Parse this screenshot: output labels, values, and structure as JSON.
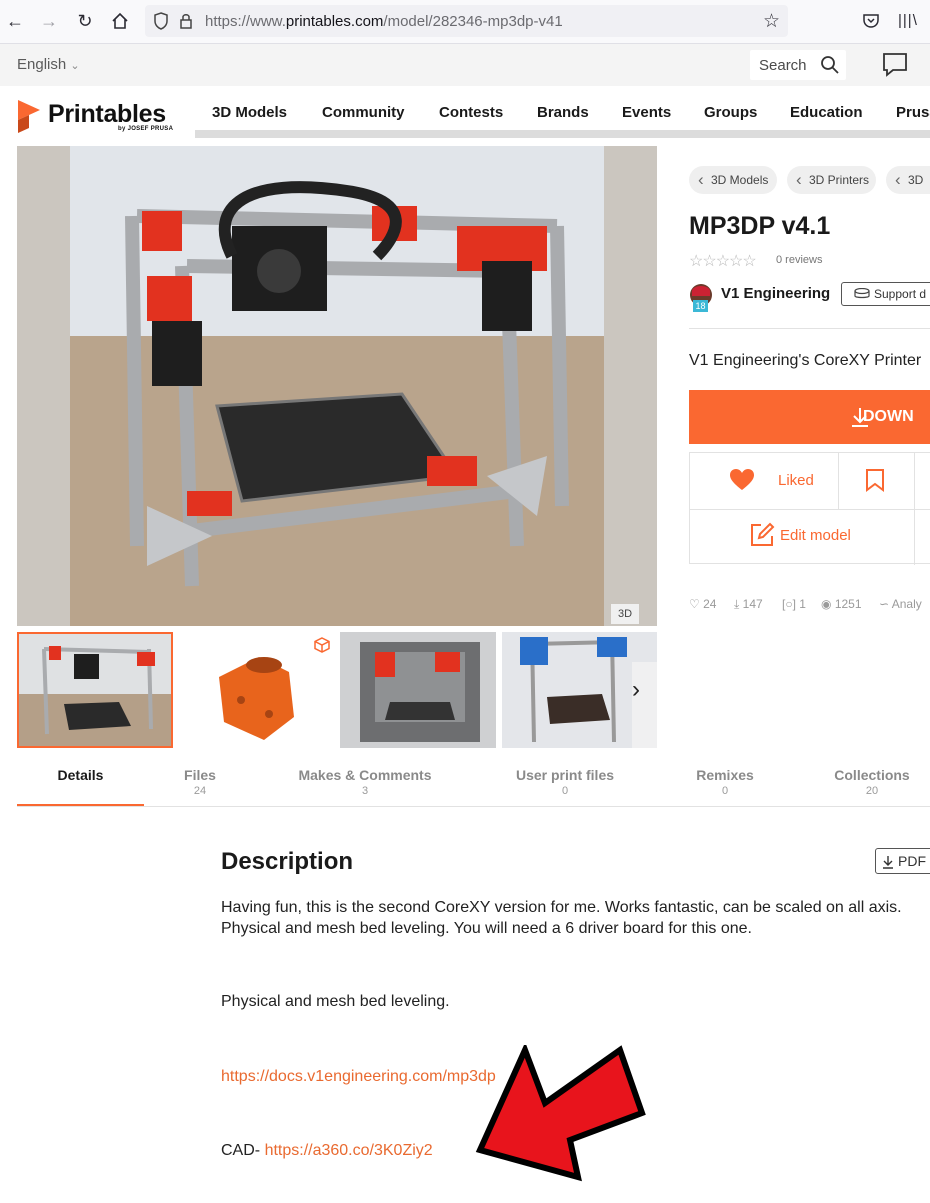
{
  "browser": {
    "url_prefix": "https://www.",
    "url_domain": "printables.com",
    "url_path": "/model/282346-mp3dp-v41"
  },
  "site": {
    "language": "English",
    "search_label": "Search",
    "logo_text": "Printables",
    "logo_sub": "by JOSEF PRUSA"
  },
  "nav": [
    "3D Models",
    "Community",
    "Contests",
    "Brands",
    "Events",
    "Groups",
    "Education",
    "Prusa"
  ],
  "gallery": {
    "badge_3d": "3D"
  },
  "breadcrumbs": [
    "3D Models",
    "3D Printers",
    "3D"
  ],
  "model": {
    "title": "MP3DP v4.1",
    "reviews": "0 reviews",
    "author": "V1 Engineering",
    "author_badge": "18",
    "support_label": "Support d",
    "summary": "V1 Engineering's CoreXY Printer",
    "download_label": "DOWN",
    "liked_label": "Liked",
    "edit_label": "Edit model"
  },
  "stats": {
    "likes": "24",
    "downloads": "147",
    "makes": "1",
    "views": "1251",
    "analytics": "Analy"
  },
  "tabs": [
    {
      "label": "Details",
      "count": ""
    },
    {
      "label": "Files",
      "count": "24"
    },
    {
      "label": "Makes & Comments",
      "count": "3"
    },
    {
      "label": "User print files",
      "count": "0"
    },
    {
      "label": "Remixes",
      "count": "0"
    },
    {
      "label": "Collections",
      "count": "20"
    }
  ],
  "description": {
    "heading": "Description",
    "pdf_label": "PDF",
    "para1": "Having fun, this is the second CoreXY version for me. Works fantastic, can be scaled on all axis. Physical and mesh bed leveling. You will need a 6 driver board for this one.",
    "para2": "Physical and mesh bed leveling.",
    "link1": "https://docs.v1engineering.com/mp3dp",
    "cad_prefix": "CAD- ",
    "cad_link": "https://a360.co/3K0Ziy2"
  },
  "colors": {
    "accent": "#fa6831",
    "link": "#e96a30",
    "arrow": "#e8141c"
  }
}
